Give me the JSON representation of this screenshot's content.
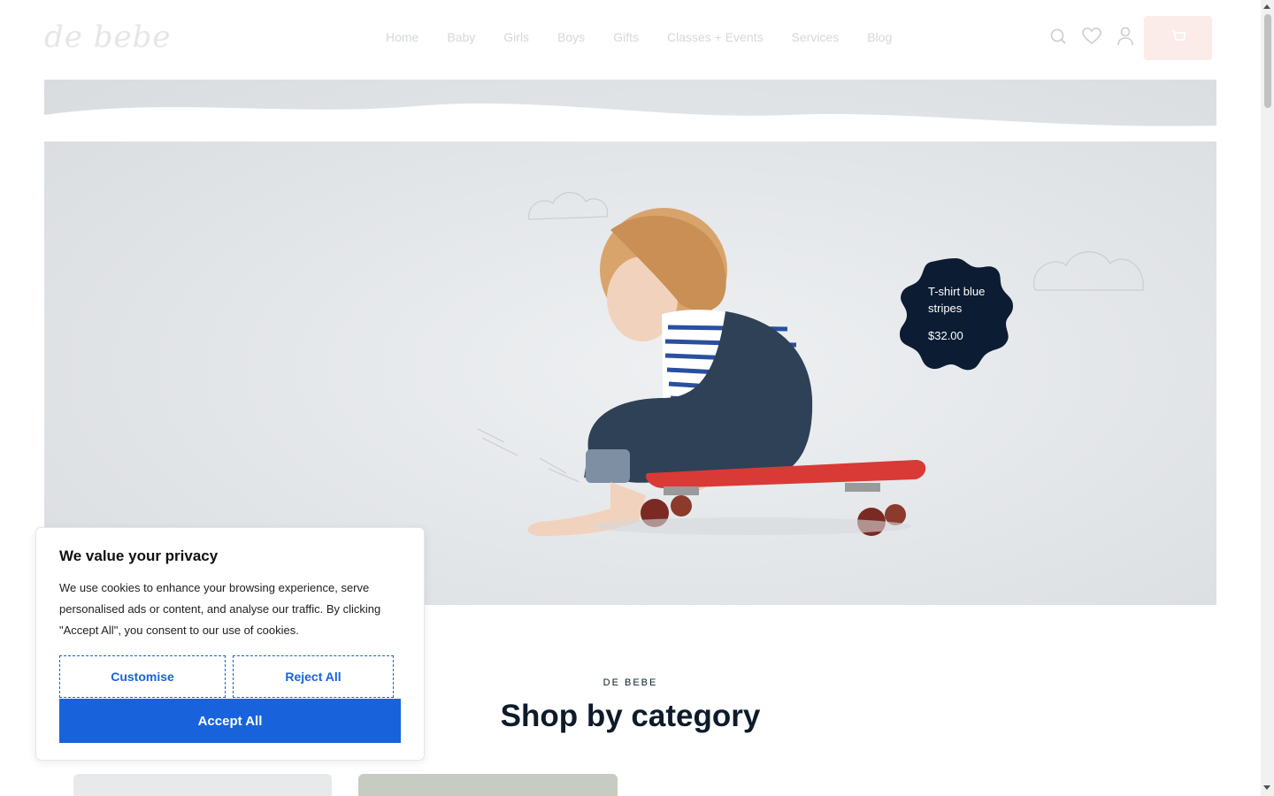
{
  "brand": {
    "logo_text": "de bebe"
  },
  "nav": {
    "items": [
      {
        "label": "Home"
      },
      {
        "label": "Baby"
      },
      {
        "label": "Girls"
      },
      {
        "label": "Boys"
      },
      {
        "label": "Gifts"
      },
      {
        "label": "Classes + Events"
      },
      {
        "label": "Services"
      },
      {
        "label": "Blog"
      }
    ]
  },
  "header_icons": [
    "search-icon",
    "heart-icon",
    "user-icon",
    "cart-icon"
  ],
  "hero": {
    "product_name": "T-shirt blue stripes",
    "product_price": "$32.00"
  },
  "section": {
    "eyebrow": "DE BEBE",
    "title": "Shop by category"
  },
  "cookie": {
    "title": "We value your privacy",
    "body": "We use cookies to enhance your browsing experience, serve personalised ads or content, and analyse our traffic. By clicking \"Accept All\", you consent to our use of cookies.",
    "customise_label": "Customise",
    "reject_label": "Reject All",
    "accept_label": "Accept All"
  },
  "colors": {
    "accent": "#1863dc",
    "navy": "#0d1b2a",
    "cart_bg": "#f7c9c2"
  }
}
